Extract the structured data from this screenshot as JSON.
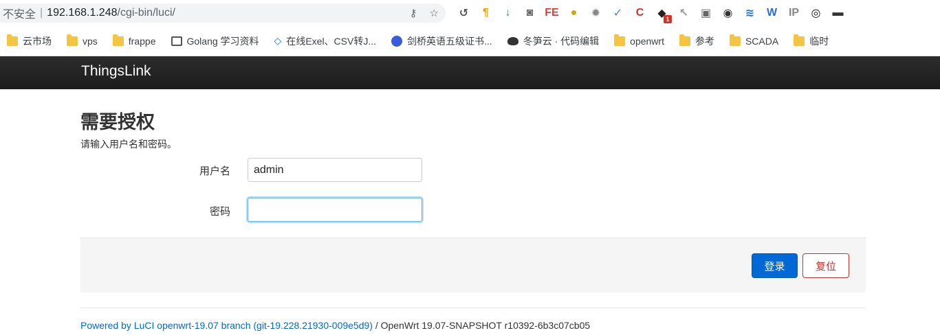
{
  "browser": {
    "security_label": "不安全",
    "separator": "|",
    "url_host": "192.168.1.248",
    "url_path": "/cgi-bin/luci/",
    "extensions": [
      {
        "name": "history-ext",
        "glyph": "↺",
        "color": "#555555"
      },
      {
        "name": "paragraph-ext",
        "glyph": "¶",
        "color": "#e8a200"
      },
      {
        "name": "download-ext",
        "glyph": "↓",
        "color": "#34a853"
      },
      {
        "name": "camera-ext",
        "glyph": "◙",
        "color": "#666666"
      },
      {
        "name": "fe-ext",
        "glyph": "FE",
        "color": "#e53935"
      },
      {
        "name": "cookie-ext",
        "glyph": "●",
        "color": "#d4a017"
      },
      {
        "name": "gear-ext",
        "glyph": "✹",
        "color": "#888888"
      },
      {
        "name": "check-ext",
        "glyph": "✓",
        "color": "#3b82f6"
      },
      {
        "name": "c-ext",
        "glyph": "C",
        "color": "#d93025"
      },
      {
        "name": "game-ext",
        "glyph": "◆",
        "color": "#222222",
        "badge": "1"
      },
      {
        "name": "cursor-ext",
        "glyph": "↖",
        "color": "#999999"
      },
      {
        "name": "screenshot-ext",
        "glyph": "▣",
        "color": "#666666"
      },
      {
        "name": "eye-ext",
        "glyph": "◉",
        "color": "#333333"
      },
      {
        "name": "wave-ext",
        "glyph": "≋",
        "color": "#1a73e8"
      },
      {
        "name": "w-ext",
        "glyph": "W",
        "color": "#2b6cde"
      },
      {
        "name": "ip-ext",
        "glyph": "IP",
        "color": "#888888"
      },
      {
        "name": "o-ext",
        "glyph": "◎",
        "color": "#111111"
      },
      {
        "name": "mask-ext",
        "glyph": "▬",
        "color": "#333333"
      }
    ]
  },
  "bookmarks": [
    {
      "label": "云市场",
      "icon": "folder"
    },
    {
      "label": "vps",
      "icon": "folder"
    },
    {
      "label": "frappe",
      "icon": "folder"
    },
    {
      "label": "Golang 学习资料",
      "icon": "book"
    },
    {
      "label": "在线Exel、CSV转J...",
      "icon": "code"
    },
    {
      "label": "剑桥英语五级证书...",
      "icon": "globe"
    },
    {
      "label": "冬笋云 · 代码编辑",
      "icon": "cloud"
    },
    {
      "label": "openwrt",
      "icon": "folder"
    },
    {
      "label": "参考",
      "icon": "folder"
    },
    {
      "label": "SCADA",
      "icon": "folder"
    },
    {
      "label": "临时",
      "icon": "folder"
    }
  ],
  "header": {
    "brand": "ThingsLink"
  },
  "login": {
    "title": "需要授权",
    "description": "请输入用户名和密码。",
    "username_label": "用户名",
    "username_value": "admin",
    "password_label": "密码",
    "password_value": "",
    "login_button": "登录",
    "reset_button": "复位"
  },
  "footer": {
    "link_text": "Powered by LuCI openwrt-19.07 branch (git-19.228.21930-009e5d9)",
    "rest_text": " / OpenWrt 19.07-SNAPSHOT r10392-6b3c07cb05"
  },
  "colors": {
    "accent": "#0069d6",
    "reset": "#c9302c",
    "topbar": "#222222"
  }
}
